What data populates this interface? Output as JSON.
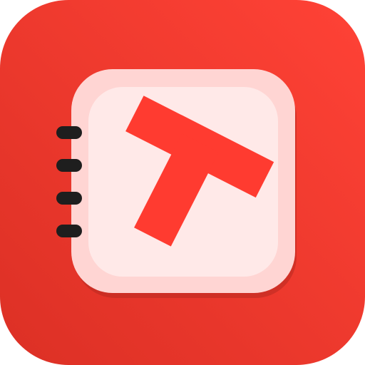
{
  "icon": {
    "name": "notebook-t-app-icon",
    "logo_letter": "T",
    "colors": {
      "background_top": "#ff4236",
      "background_bottom": "#dc3025",
      "notebook_frame": "#ffd5d3",
      "notebook_page": "#ffe9e8",
      "notebook_shadow": "#b82a20",
      "letter": "#ff3b30",
      "ring": "#1e1e1e"
    },
    "ring_count": 4
  }
}
